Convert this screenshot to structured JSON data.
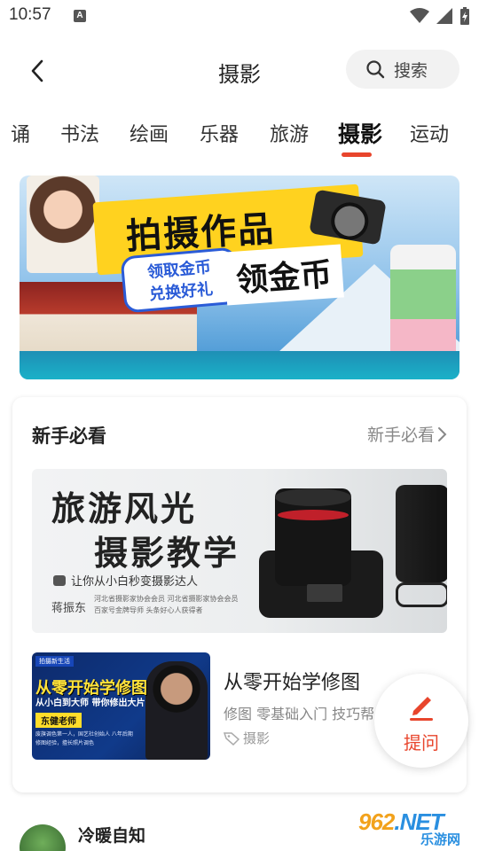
{
  "status_bar": {
    "time": "10:57",
    "notification_icon": "A"
  },
  "header": {
    "title": "摄影",
    "search_label": "搜索"
  },
  "tabs": [
    {
      "label": "诵",
      "active": false
    },
    {
      "label": "书法",
      "active": false
    },
    {
      "label": "绘画",
      "active": false
    },
    {
      "label": "乐器",
      "active": false
    },
    {
      "label": "旅游",
      "active": false
    },
    {
      "label": "摄影",
      "active": true
    },
    {
      "label": "运动",
      "active": false
    }
  ],
  "banner": {
    "title": "拍摄作品",
    "pill_line1": "领取金币",
    "pill_line2": "兑换好礼",
    "subtitle": "领金币"
  },
  "section": {
    "title": "新手必看",
    "more_label": "新手必看"
  },
  "feature": {
    "title_line1": "旅游风光",
    "title_line2": "摄影教学",
    "tagline": "让你从小白秒变摄影达人",
    "author": "蒋振东",
    "credits": [
      "河北省摄影家协会会员",
      "河北省摄影家协会会员",
      "百家号金牌导师",
      "头条好心人获得者"
    ]
  },
  "course": {
    "thumb_badge": "拍摄新生活",
    "thumb_title": "从零开始学修图",
    "thumb_subtitle": "从小白到大师 带你修出大片",
    "thumb_teacher": "东健老师",
    "thumb_desc": "废旗调色第一人，国艺社创始人 八年后期修图经验，擅长照片调色",
    "title": "从零开始学修图",
    "description": "修图 零基础入门 技巧帮",
    "tag": "摄影"
  },
  "ask_button": {
    "label": "提问"
  },
  "post": {
    "username": "冷暖自知"
  },
  "watermark": {
    "logo_part1": "962",
    "logo_part2": ".NET",
    "sub": "乐游网"
  },
  "colors": {
    "accent": "#e8452c",
    "tab_underline": "#e8452c",
    "muted_text": "#888888"
  }
}
